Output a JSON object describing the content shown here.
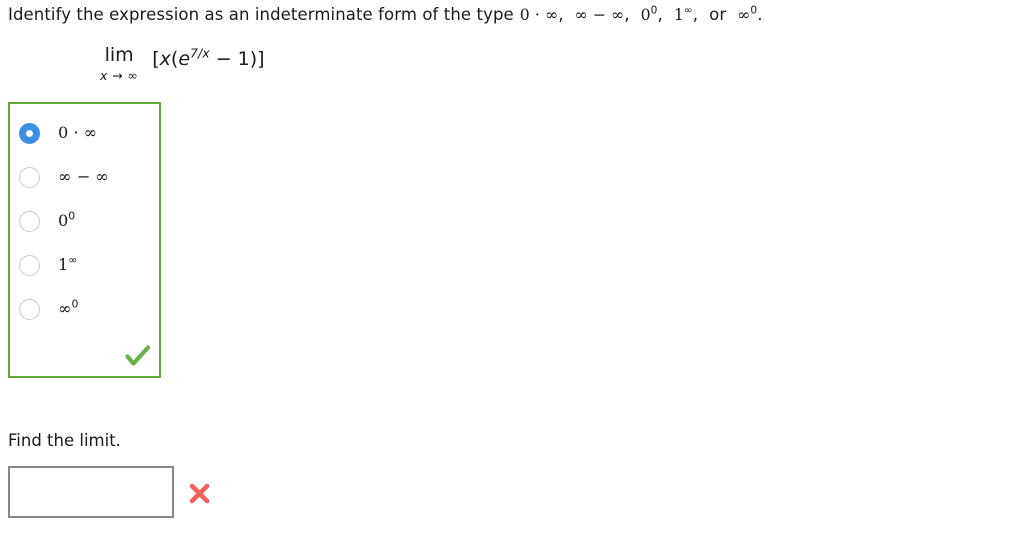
{
  "question": {
    "prompt_prefix": "Identify the expression as an indeterminate form of the type",
    "types": [
      {
        "base": "0 · ∞",
        "exp": "",
        "trail": ","
      },
      {
        "base": "∞ − ∞",
        "exp": "",
        "trail": ","
      },
      {
        "base": "0",
        "exp": "0",
        "trail": ","
      },
      {
        "base": "1",
        "exp": "∞",
        "trail": ","
      },
      {
        "base": "∞",
        "exp": "0",
        "trail": "."
      }
    ],
    "or_word": "or"
  },
  "expression": {
    "lim_word": "lim",
    "lim_subscript": "x → ∞",
    "body_open": "[",
    "body_var": "x",
    "body_paren_open": "(",
    "body_e": "e",
    "body_e_exponent": "7/x",
    "body_rest": " − 1",
    "body_paren_close": ")",
    "body_close": "]"
  },
  "options": {
    "selected_index": 0,
    "items": [
      {
        "base": "0 · ∞",
        "exp": ""
      },
      {
        "base": "∞ − ∞",
        "exp": ""
      },
      {
        "base": "0",
        "exp": "0"
      },
      {
        "base": "1",
        "exp": "∞"
      },
      {
        "base": "∞",
        "exp": "0"
      }
    ],
    "feedback": "correct",
    "border_color": "#5fa839",
    "selected_color": "#3b8fe8"
  },
  "second_part": {
    "label": "Find the limit.",
    "answer_value": "",
    "answer_placeholder": "",
    "feedback": "incorrect",
    "incorrect_color": "#f4605a"
  }
}
